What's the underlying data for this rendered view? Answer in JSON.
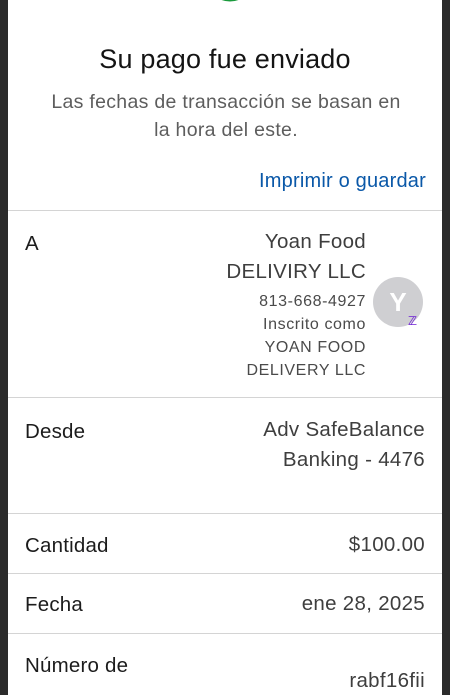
{
  "header": {
    "title": "Su pago fue enviado",
    "subtitle_line1": "Las fechas de transacción se basan en",
    "subtitle_line2": "la hora del este.",
    "print_label": "Imprimir o guardar"
  },
  "recipient": {
    "label": "A",
    "name_line1": "Yoan Food",
    "name_line2": "DELIVIRY LLC",
    "phone": "813-668-4927",
    "enrolled_line1": "Inscrito como",
    "enrolled_line2": "YOAN FOOD",
    "enrolled_line3": "DELIVERY LLC",
    "avatar_initial": "Y",
    "badge_icon": "zelle-logo-icon"
  },
  "from": {
    "label": "Desde",
    "value_line1": "Adv SafeBalance",
    "value_line2": "Banking - 4476"
  },
  "amount": {
    "label": "Cantidad",
    "value": "$100.00"
  },
  "date": {
    "label": "Fecha",
    "value": "ene 28, 2025"
  },
  "confirmation": {
    "label": "Número de",
    "value": "rabf16fii"
  },
  "icons": {
    "success": "checkmark-circle-icon"
  },
  "colors": {
    "accent": "#0a58a8",
    "success": "#1a9a3c",
    "zelle": "#6d1ed4"
  }
}
